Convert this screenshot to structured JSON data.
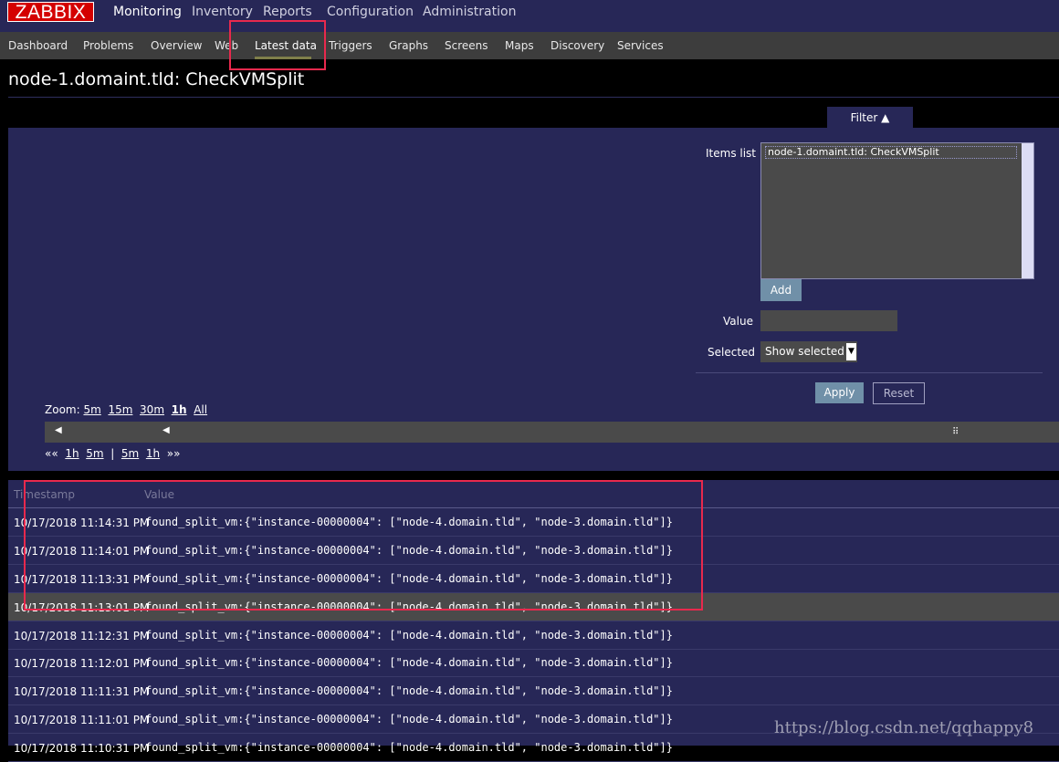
{
  "app": {
    "logo": "ZABBIX"
  },
  "main_menu": [
    "Monitoring",
    "Inventory",
    "Reports",
    "Configuration",
    "Administration"
  ],
  "sub_menu": [
    "Dashboard",
    "Problems",
    "Overview",
    "Web",
    "Latest data",
    "Triggers",
    "Graphs",
    "Screens",
    "Maps",
    "Discovery",
    "Services"
  ],
  "page": {
    "title": "node-1.domaint.tld: CheckVMSplit"
  },
  "filter": {
    "tab_label": "Filter ▲",
    "items_list_label": "Items list",
    "items": [
      "node-1.domaint.tld: CheckVMSplit"
    ],
    "add_label": "Add",
    "value_label": "Value",
    "value": "",
    "selected_label": "Selected",
    "selected_value": "Show selected",
    "apply_label": "Apply",
    "reset_label": "Reset"
  },
  "zoom": {
    "label": "Zoom:",
    "options": [
      "5m",
      "15m",
      "30m",
      "1h",
      "All"
    ],
    "active": "1h",
    "nav": {
      "back_fast": "««",
      "back1": "1h",
      "back2": "5m",
      "sep": "|",
      "fwd1": "5m",
      "fwd2": "1h",
      "fwd_fast": "»»"
    }
  },
  "table": {
    "columns": [
      "Timestamp",
      "Value"
    ],
    "rows": [
      {
        "ts": "10/17/2018 11:14:31 PM",
        "value": "found_split_vm:{\"instance-00000004\": [\"node-4.domain.tld\", \"node-3.domain.tld\"]}"
      },
      {
        "ts": "10/17/2018 11:14:01 PM",
        "value": "found_split_vm:{\"instance-00000004\": [\"node-4.domain.tld\", \"node-3.domain.tld\"]}"
      },
      {
        "ts": "10/17/2018 11:13:31 PM",
        "value": "found_split_vm:{\"instance-00000004\": [\"node-4.domain.tld\", \"node-3.domain.tld\"]}"
      },
      {
        "ts": "10/17/2018 11:13:01 PM",
        "value": "found_split_vm:{\"instance-00000004\": [\"node-4.domain.tld\", \"node-3.domain.tld\"]}"
      },
      {
        "ts": "10/17/2018 11:12:31 PM",
        "value": "found_split_vm:{\"instance-00000004\": [\"node-4.domain.tld\", \"node-3.domain.tld\"]}"
      },
      {
        "ts": "10/17/2018 11:12:01 PM",
        "value": "found_split_vm:{\"instance-00000004\": [\"node-4.domain.tld\", \"node-3.domain.tld\"]}"
      },
      {
        "ts": "10/17/2018 11:11:31 PM",
        "value": "found_split_vm:{\"instance-00000004\": [\"node-4.domain.tld\", \"node-3.domain.tld\"]}"
      },
      {
        "ts": "10/17/2018 11:11:01 PM",
        "value": "found_split_vm:{\"instance-00000004\": [\"node-4.domain.tld\", \"node-3.domain.tld\"]}"
      },
      {
        "ts": "10/17/2018 11:10:31 PM",
        "value": "found_split_vm:{\"instance-00000004\": [\"node-4.domain.tld\", \"node-3.domain.tld\"]}"
      }
    ]
  },
  "watermark": "https://blog.csdn.net/qqhappy8",
  "colors": {
    "logo_red": "#d40000",
    "nav_bg": "#272757",
    "highlight_red": "#e8294d"
  }
}
